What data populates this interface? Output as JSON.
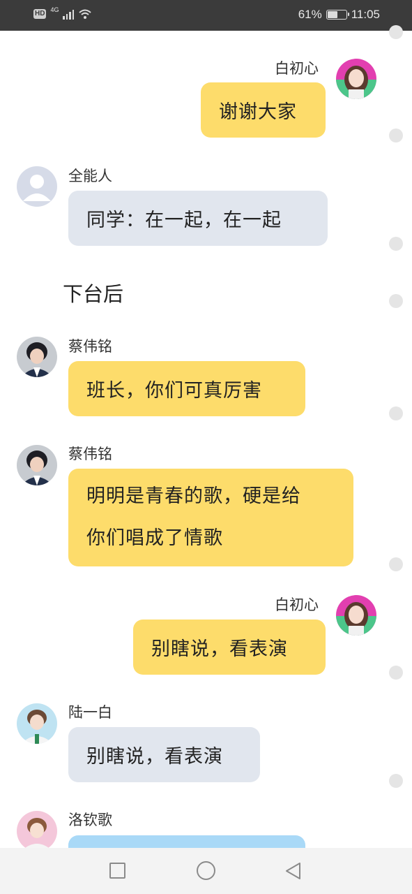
{
  "status_bar": {
    "hd": "HD",
    "network": "4G",
    "battery": "61%",
    "battery_level": 0.61,
    "time": "11:05"
  },
  "messages": [
    {
      "sender": "白初心",
      "text": "谢谢大家",
      "side": "right",
      "color": "yellow",
      "avatar": "girl-avatar"
    },
    {
      "sender": "全能人",
      "text": "同学：在一起，在一起",
      "side": "left",
      "color": "gray",
      "avatar": "default-user-avatar"
    },
    {
      "sender": "蔡伟铭",
      "text": "班长，你们可真厉害",
      "side": "left",
      "color": "yellow",
      "avatar": "boy-avatar"
    },
    {
      "sender": "蔡伟铭",
      "lines": [
        "明明是青春的歌，硬是给",
        "你们唱成了情歌"
      ],
      "side": "left",
      "color": "yellow",
      "avatar": "boy-avatar"
    },
    {
      "sender": "白初心",
      "text": "别瞎说，看表演",
      "side": "right",
      "color": "yellow",
      "avatar": "girl-avatar"
    },
    {
      "sender": "陆一白",
      "text": "别瞎说，看表演",
      "side": "left",
      "color": "gray",
      "avatar": "boy-avatar"
    },
    {
      "sender": "洛钦歌",
      "text": "",
      "side": "left",
      "color": "blue",
      "avatar": "boy-avatar"
    }
  ],
  "narration": "下台后"
}
